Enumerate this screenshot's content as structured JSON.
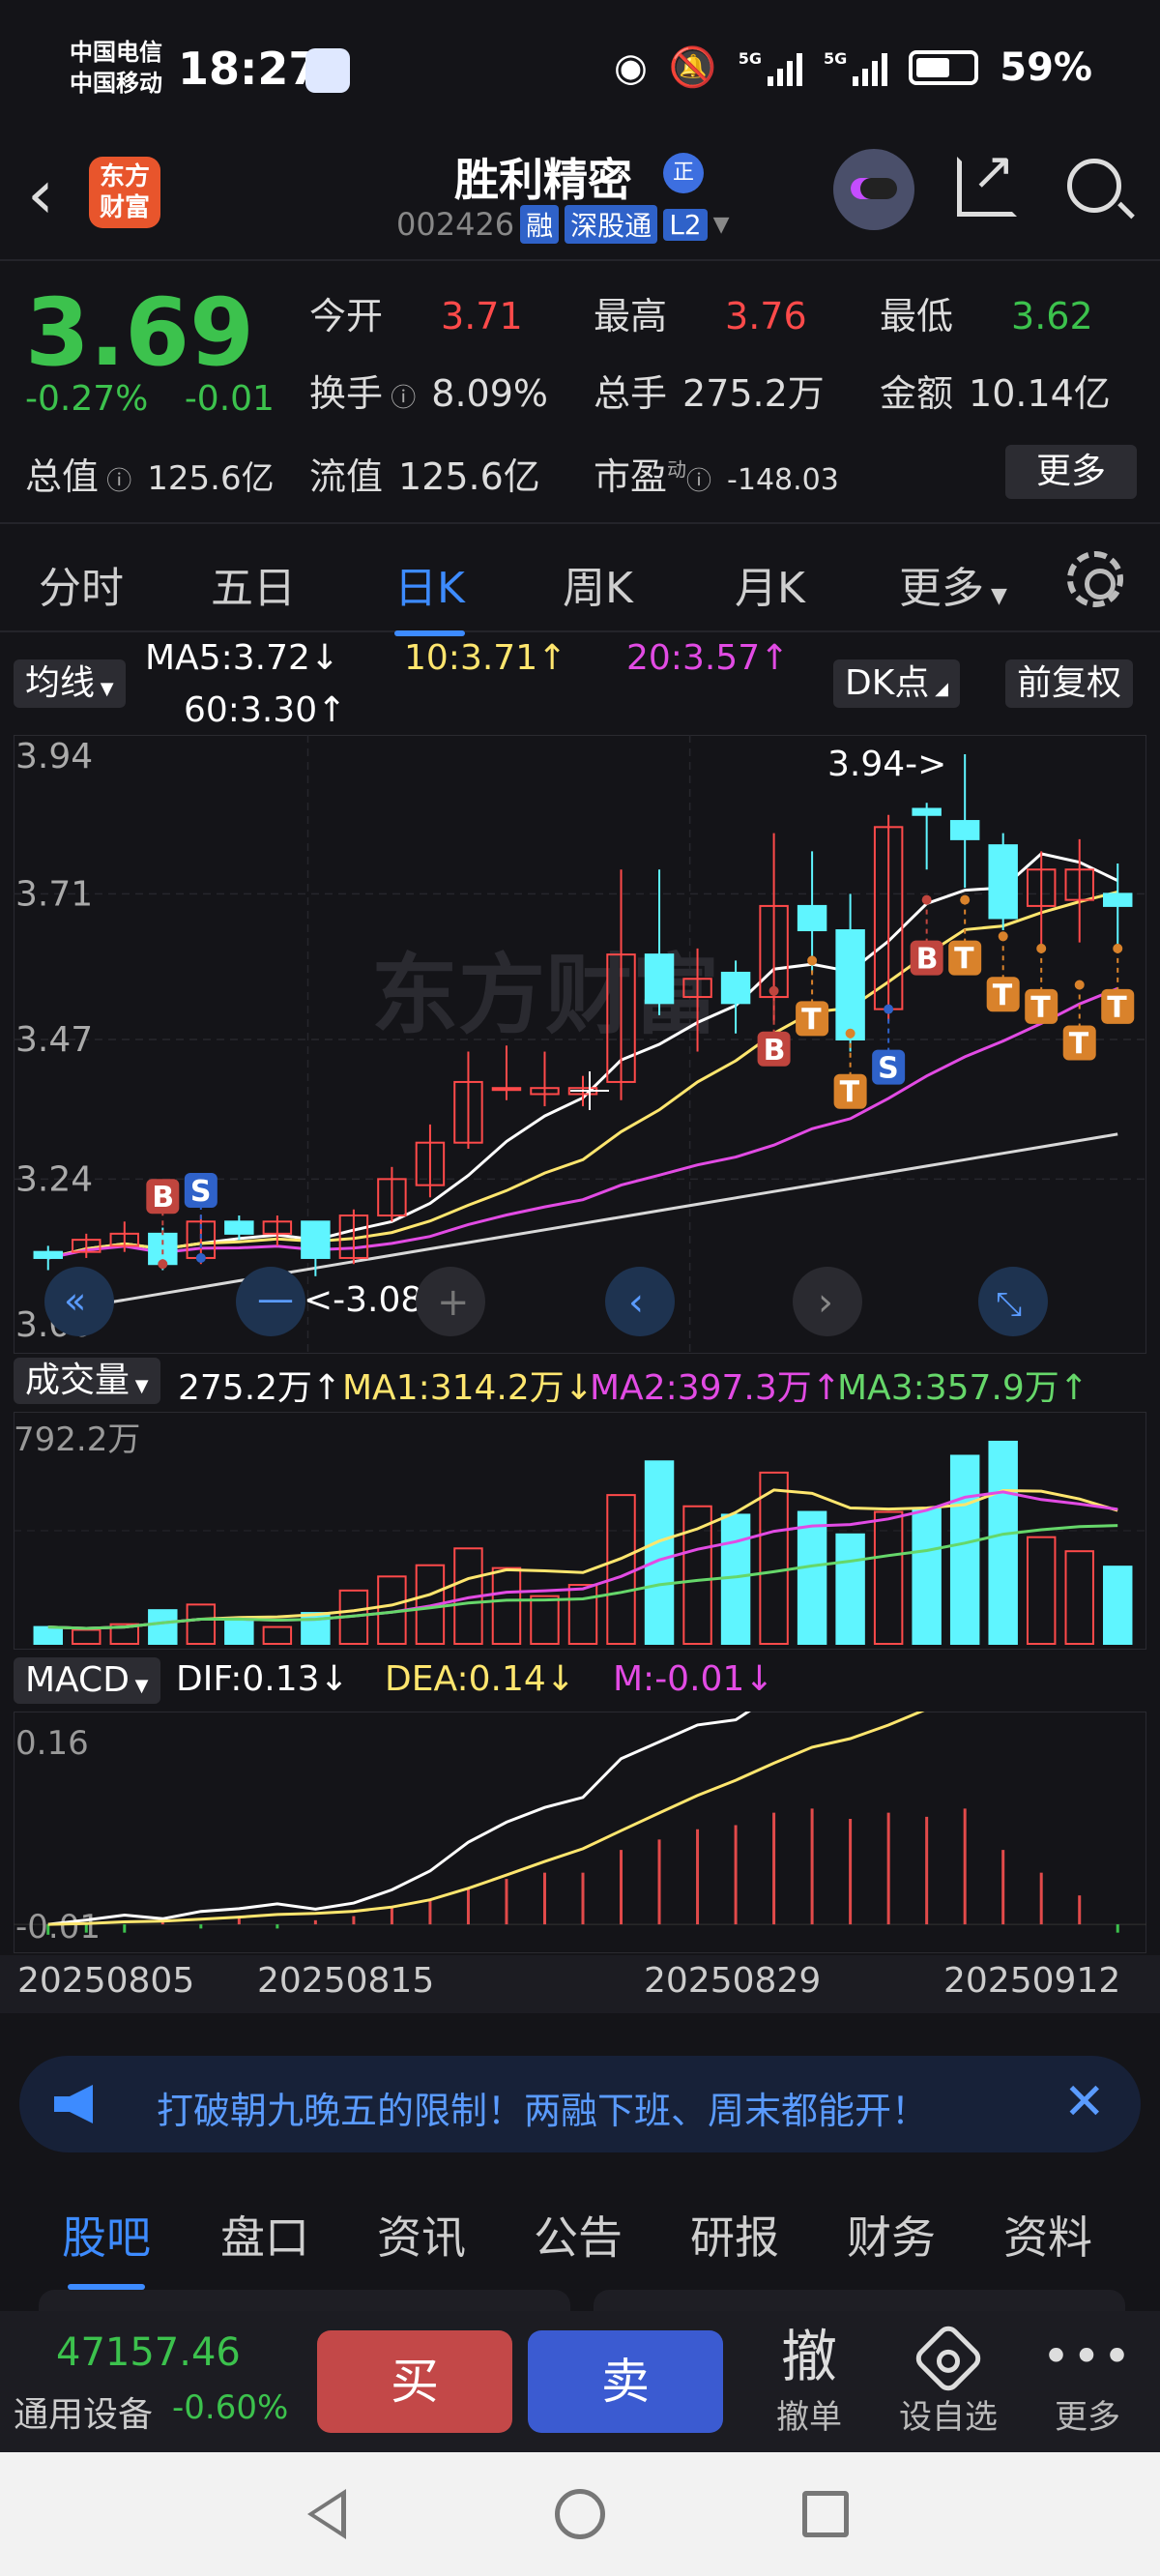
{
  "status": {
    "carrier1": "中国电信",
    "carrier2": "中国移动",
    "time": "18:27",
    "net1": "5G",
    "net2": "5G",
    "battery": "59%"
  },
  "header": {
    "logo_text_1": "东方",
    "logo_text_2": "财富",
    "name": "胜利精密",
    "badge": "正",
    "code": "002426",
    "tags": [
      "融",
      "深股通",
      "L2"
    ]
  },
  "quote": {
    "price": "3.69",
    "change_pct": "-0.27%",
    "change_amt": "-0.01",
    "fields": {
      "open_label": "今开",
      "open": "3.71",
      "high_label": "最高",
      "high": "3.76",
      "low_label": "最低",
      "low": "3.62",
      "turnover_label": "换手",
      "turnover": "8.09%",
      "volume_label": "总手",
      "volume": "275.2万",
      "amount_label": "金额",
      "amount": "10.14亿",
      "mktcap_label": "总值",
      "mktcap": "125.6亿",
      "float_label": "流值",
      "float": "125.6亿",
      "pe_label": "市盈",
      "pe_sup": "动",
      "pe": "-148.03"
    },
    "more": "更多"
  },
  "period_tabs": [
    "分时",
    "五日",
    "日K",
    "周K",
    "月K",
    "更多"
  ],
  "active_period": "日K",
  "ma_row": {
    "selector": "均线",
    "ma5": "MA5:3.72↓",
    "ma10": "10:3.71↑",
    "ma20": "20:3.57↑",
    "ma60": "60:3.30↑",
    "dk": "DK点",
    "adjust": "前复权"
  },
  "kline": {
    "y_labels": [
      "3.94",
      "3.71",
      "3.47",
      "3.24",
      "3.00"
    ],
    "high_note": "3.94->",
    "low_note": "<-3.08",
    "marks": {
      "B": "B",
      "S": "S",
      "T": "T"
    }
  },
  "volume_row": {
    "selector": "成交量",
    "vol": "275.2万↑",
    "ma1": "MA1:314.2万↓",
    "ma2": "MA2:397.3万↑",
    "ma3": "MA3:357.9万↑",
    "max_label": "792.2万"
  },
  "macd_row": {
    "selector": "MACD",
    "dif": "DIF:0.13↓",
    "dea": "DEA:0.14↓",
    "m": "M:-0.01↓",
    "top_label": "0.16",
    "bottom_label": "-0.01"
  },
  "x_dates": [
    "20250805",
    "20250815",
    "20250829",
    "20250912"
  ],
  "news": {
    "text": "打破朝九晚五的限制！两融下班、周末都能开！"
  },
  "bottom_tabs": [
    "股吧",
    "盘口",
    "资讯",
    "公告",
    "研报",
    "财务",
    "资料"
  ],
  "active_bottom_tab": "股吧",
  "tradebar": {
    "index_value": "47157.46",
    "index_name": "通用设备",
    "index_change": "-0.60%",
    "buy": "买",
    "sell": "卖",
    "cancel_big": "撤",
    "cancel_label": "撤单",
    "watch_label": "设自选",
    "more_label": "更多"
  },
  "colors": {
    "up": "#ff4a4a",
    "down": "#3cc24d",
    "hollow_up": "#ff4a4a",
    "filled_down": "#5ff5ff",
    "accent": "#3d8bff"
  },
  "chart_data": {
    "type": "candlestick",
    "price_range": [
      3.0,
      3.94
    ],
    "candles": [
      {
        "o": 3.12,
        "c": 3.11,
        "h": 3.13,
        "l": 3.09
      },
      {
        "o": 3.12,
        "c": 3.14,
        "h": 3.15,
        "l": 3.11
      },
      {
        "o": 3.13,
        "c": 3.15,
        "h": 3.17,
        "l": 3.12
      },
      {
        "o": 3.15,
        "c": 3.1,
        "h": 3.16,
        "l": 3.09
      },
      {
        "o": 3.11,
        "c": 3.17,
        "h": 3.18,
        "l": 3.1
      },
      {
        "o": 3.17,
        "c": 3.15,
        "h": 3.18,
        "l": 3.14
      },
      {
        "o": 3.15,
        "c": 3.17,
        "h": 3.18,
        "l": 3.13
      },
      {
        "o": 3.17,
        "c": 3.11,
        "h": 3.17,
        "l": 3.08
      },
      {
        "o": 3.11,
        "c": 3.18,
        "h": 3.19,
        "l": 3.1
      },
      {
        "o": 3.18,
        "c": 3.24,
        "h": 3.26,
        "l": 3.17
      },
      {
        "o": 3.23,
        "c": 3.3,
        "h": 3.33,
        "l": 3.21
      },
      {
        "o": 3.3,
        "c": 3.4,
        "h": 3.45,
        "l": 3.29
      },
      {
        "o": 3.39,
        "c": 3.39,
        "h": 3.46,
        "l": 3.37
      },
      {
        "o": 3.38,
        "c": 3.39,
        "h": 3.45,
        "l": 3.36
      },
      {
        "o": 3.38,
        "c": 3.39,
        "h": 3.41,
        "l": 3.36
      },
      {
        "o": 3.4,
        "c": 3.61,
        "h": 3.75,
        "l": 3.37
      },
      {
        "o": 3.61,
        "c": 3.53,
        "h": 3.75,
        "l": 3.51
      },
      {
        "o": 3.54,
        "c": 3.57,
        "h": 3.62,
        "l": 3.45
      },
      {
        "o": 3.58,
        "c": 3.53,
        "h": 3.6,
        "l": 3.48
      },
      {
        "o": 3.54,
        "c": 3.69,
        "h": 3.81,
        "l": 3.5
      },
      {
        "o": 3.69,
        "c": 3.65,
        "h": 3.78,
        "l": 3.58
      },
      {
        "o": 3.65,
        "c": 3.47,
        "h": 3.71,
        "l": 3.45
      },
      {
        "o": 3.52,
        "c": 3.82,
        "h": 3.84,
        "l": 3.5
      },
      {
        "o": 3.85,
        "c": 3.84,
        "h": 3.86,
        "l": 3.75
      },
      {
        "o": 3.83,
        "c": 3.8,
        "h": 3.94,
        "l": 3.72
      },
      {
        "o": 3.79,
        "c": 3.67,
        "h": 3.81,
        "l": 3.65
      },
      {
        "o": 3.69,
        "c": 3.75,
        "h": 3.78,
        "l": 3.62
      },
      {
        "o": 3.7,
        "c": 3.75,
        "h": 3.8,
        "l": 3.63
      },
      {
        "o": 3.71,
        "c": 3.69,
        "h": 3.76,
        "l": 3.62
      }
    ],
    "volume": [
      60,
      50,
      70,
      120,
      140,
      90,
      60,
      110,
      190,
      240,
      280,
      340,
      270,
      170,
      210,
      530,
      650,
      490,
      460,
      610,
      470,
      390,
      470,
      480,
      670,
      720,
      380,
      330,
      275
    ],
    "macd_hist": [
      -0.005,
      -0.004,
      -0.004,
      0.002,
      -0.002,
      0.003,
      -0.002,
      0.002,
      0.004,
      0.008,
      0.012,
      0.018,
      0.022,
      0.025,
      0.025,
      0.036,
      0.041,
      0.046,
      0.048,
      0.054,
      0.056,
      0.051,
      0.054,
      0.052,
      0.056,
      0.036,
      0.025,
      0.014,
      -0.004
    ]
  }
}
